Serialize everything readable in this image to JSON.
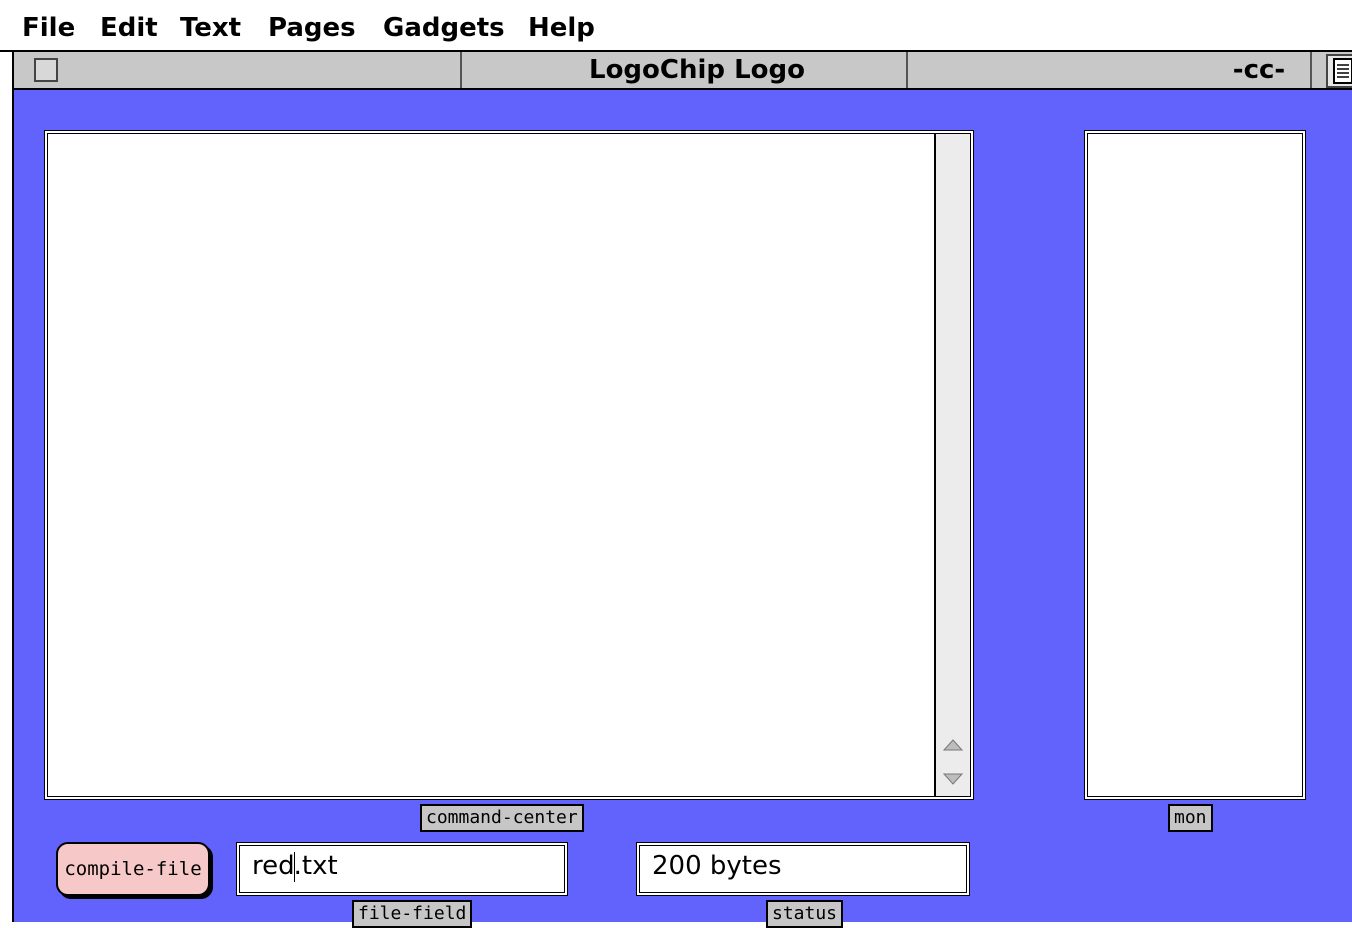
{
  "menu": {
    "items": [
      "File",
      "Edit",
      "Text",
      "Pages",
      "Gadgets",
      "Help"
    ]
  },
  "window": {
    "title": "LogoChip Logo",
    "page_name": "-cc-"
  },
  "gadgets": {
    "command_center_label": "command-center",
    "mon_label": "mon",
    "compile_button_label": "compile-file",
    "file_field": {
      "label": "file-field",
      "value_before_caret": "red",
      "value_after_caret": ".txt"
    },
    "status": {
      "label": "status",
      "value": "200 bytes"
    }
  },
  "colors": {
    "workspace": "#6262fc",
    "button": "#f6c8c8",
    "label_bg": "#c6c6c6"
  },
  "icons": {
    "close_box": "close-box-icon",
    "page_icon": "page-icon",
    "scroll_up": "scroll-up-arrow-icon",
    "scroll_down": "scroll-down-arrow-icon"
  }
}
